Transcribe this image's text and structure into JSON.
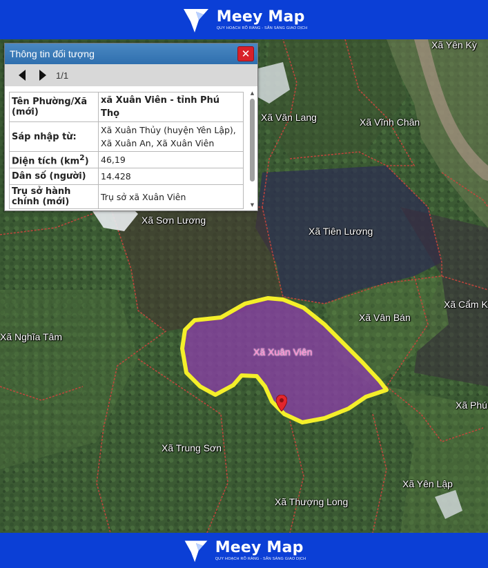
{
  "brand": {
    "name": "Meey Map",
    "tagline": "QUY HOẠCH RÕ RÀNG - SẴN SÀNG GIAO DỊCH",
    "color": "#0b3fd6"
  },
  "popup": {
    "title": "Thông tin đối tượng",
    "close_icon": "close-icon",
    "pager": "1/1",
    "rows": [
      {
        "key": "Tên Phường/Xã (mới)",
        "value": "xã Xuân Viên - tỉnh Phú Thọ"
      },
      {
        "key": "Sáp nhập từ:",
        "value": "Xã Xuân Thủy (huyện Yên Lập), Xã Xuân An, Xã Xuân Viên"
      },
      {
        "key_main": "Diện tích (km",
        "key_sup": "2",
        "key_end": ")",
        "value": "46,19"
      },
      {
        "key": "Dân số (người)",
        "value": "14.428"
      },
      {
        "key": "Trụ sở hành chính (mới)",
        "value": "Trụ sở xã Xuân Viên"
      }
    ]
  },
  "map": {
    "highlight_color": "#f4ef2a",
    "selected_fill": "#8a3fa6",
    "selected_label": "Xã Xuân Viên",
    "places": [
      "Xã Yên Kỳ",
      "Xã Văn Lang",
      "Xã Vĩnh Chân",
      "Xã Sơn Lương",
      "Xã Tiên Lương",
      "Xã Cẩm K",
      "Xã Vân Bán",
      "Xã Nghĩa Tâm",
      "Xã Phú",
      "Xã Trung Sơn",
      "Xã Yên Lập",
      "Xã Thượng Long"
    ]
  }
}
